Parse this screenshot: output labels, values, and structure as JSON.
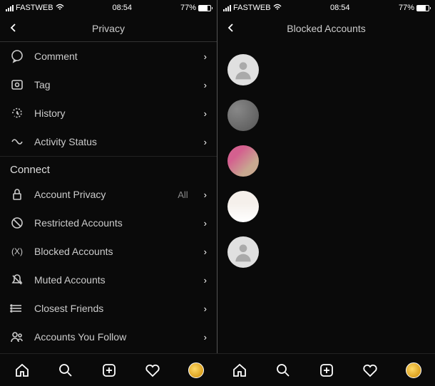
{
  "status": {
    "carrier": "FASTWEB",
    "time": "08:54",
    "battery_pct": "77%"
  },
  "left": {
    "title": "Privacy",
    "items": [
      {
        "icon": "comment-icon",
        "label": "Comment"
      },
      {
        "icon": "tag-icon",
        "label": "Tag"
      },
      {
        "icon": "history-icon",
        "label": "History"
      },
      {
        "icon": "activity-icon",
        "label": "Activity Status"
      }
    ],
    "section": "Connect",
    "items2": [
      {
        "icon": "lock-icon",
        "label": "Account Privacy",
        "value": "All"
      },
      {
        "icon": "restricted-icon",
        "label": "Restricted Accounts"
      },
      {
        "icon": "blocked-icon",
        "label": "Blocked Accounts"
      },
      {
        "icon": "muted-icon",
        "label": "Muted Accounts"
      },
      {
        "icon": "closest-icon",
        "label": "Closest Friends"
      },
      {
        "icon": "follow-icon",
        "label": "Accounts You Follow"
      }
    ]
  },
  "right": {
    "title": "Blocked Accounts",
    "accounts": [
      {
        "type": "placeholder"
      },
      {
        "type": "photo1"
      },
      {
        "type": "photo2"
      },
      {
        "type": "photo3"
      },
      {
        "type": "placeholder"
      }
    ]
  }
}
